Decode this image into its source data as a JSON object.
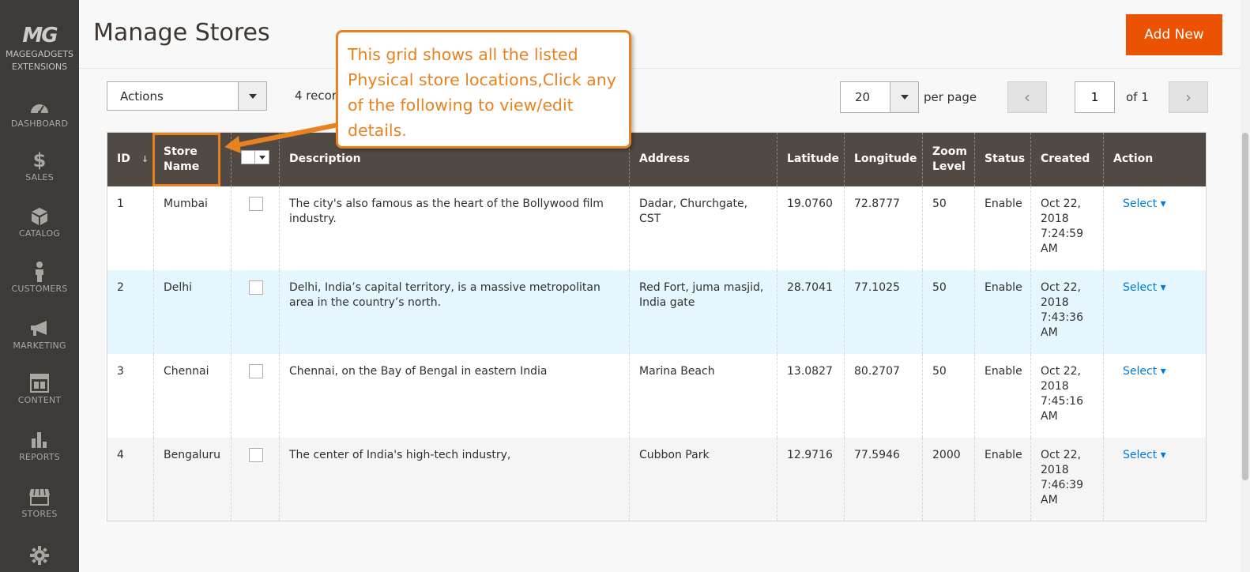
{
  "sidebar": {
    "logo_mark": "MG",
    "logo_line1": "MAGEGADGETS",
    "logo_line2": "EXTENSIONS",
    "items": [
      {
        "label": "DASHBOARD",
        "icon": "dashboard-icon"
      },
      {
        "label": "SALES",
        "icon": "dollar-icon"
      },
      {
        "label": "CATALOG",
        "icon": "box-icon"
      },
      {
        "label": "CUSTOMERS",
        "icon": "person-icon"
      },
      {
        "label": "MARKETING",
        "icon": "megaphone-icon"
      },
      {
        "label": "CONTENT",
        "icon": "layout-icon"
      },
      {
        "label": "REPORTS",
        "icon": "bar-chart-icon"
      },
      {
        "label": "STORES",
        "icon": "storefront-icon"
      },
      {
        "label": "",
        "icon": "gear-icon"
      }
    ]
  },
  "header": {
    "title": "Manage Stores",
    "add_new_label": "Add New"
  },
  "toolbar": {
    "actions_label": "Actions",
    "records_text": "4 recor",
    "per_page_value": "20",
    "per_page_label": "per page",
    "current_page": "1",
    "of_pages": "of 1"
  },
  "callout": {
    "line1": "This grid shows all the listed",
    "line2": "Physical store locations,Click any",
    "line3": "of the following to view/edit",
    "line4": "details.",
    "color": "#e8821f"
  },
  "grid": {
    "headers": {
      "id": "ID",
      "store_name_1": "Store",
      "store_name_2": "Name",
      "description": "Description",
      "address": "Address",
      "latitude": "Latitude",
      "longitude": "Longitude",
      "zoom_1": "Zoom",
      "zoom_2": "Level",
      "status": "Status",
      "created": "Created",
      "action": "Action"
    },
    "rows": [
      {
        "id": "1",
        "name": "Mumbai",
        "description": "The city's also famous as the heart of the Bollywood film industry.",
        "address": "Dadar, Churchgate, CST",
        "latitude": "19.0760",
        "longitude": "72.8777",
        "zoom": "50",
        "status": "Enable",
        "created_1": "Oct 22,",
        "created_2": "2018",
        "created_3": "7:24:59",
        "created_4": "AM",
        "action": "Select"
      },
      {
        "id": "2",
        "name": "Delhi",
        "description": "Delhi, India’s capital territory, is a massive metropolitan area in the country’s north.",
        "address": "Red Fort, juma masjid, India gate",
        "latitude": "28.7041",
        "longitude": "77.1025",
        "zoom": "50",
        "status": "Enable",
        "created_1": "Oct 22,",
        "created_2": "2018",
        "created_3": "7:43:36",
        "created_4": "AM",
        "action": "Select"
      },
      {
        "id": "3",
        "name": "Chennai",
        "description": "Chennai, on the Bay of Bengal in eastern India",
        "address": "Marina Beach",
        "latitude": "13.0827",
        "longitude": "80.2707",
        "zoom": "50",
        "status": "Enable",
        "created_1": "Oct 22,",
        "created_2": "2018",
        "created_3": "7:45:16",
        "created_4": "AM",
        "action": "Select"
      },
      {
        "id": "4",
        "name": "Bengaluru",
        "description": "The center of India's high-tech industry,",
        "address": "Cubbon Park",
        "latitude": "12.9716",
        "longitude": "77.5946",
        "zoom": "2000",
        "status": "Enable",
        "created_1": "Oct 22,",
        "created_2": "2018",
        "created_3": "7:46:39",
        "created_4": "AM",
        "action": "Select"
      }
    ]
  }
}
